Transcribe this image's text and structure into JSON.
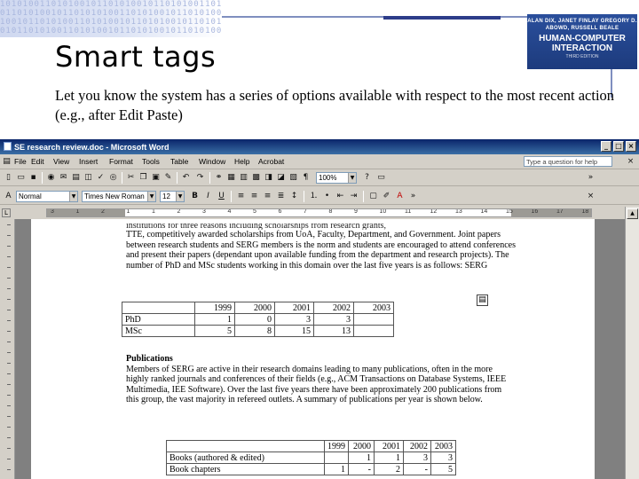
{
  "slide": {
    "title": "Smart tags",
    "subtitle": "Let you know the system has a series of options available with respect to the most recent action (e.g., after Edit Paste)",
    "book_cover": {
      "authors": "ALAN DIX, JANET FINLAY GREGORY D. ABOWD, RUSSELL BEALE",
      "title": "HUMAN-COMPUTER INTERACTION",
      "edition": "THIRD EDITION"
    }
  },
  "word": {
    "window_title": "SE research review.doc - Microsoft Word",
    "menu": [
      "File",
      "Edit",
      "View",
      "Insert",
      "Format",
      "Tools",
      "Table",
      "Window",
      "Help",
      "Acrobat"
    ],
    "ask_box_placeholder": "Type a question for help",
    "style_value": "Normal",
    "font_value": "Times New Roman",
    "size_value": "12",
    "zoom_value": "100%",
    "ruler_numbers": [
      "3",
      "1",
      "2",
      "1",
      "1",
      "2",
      "3",
      "4",
      "5",
      "6",
      "7",
      "8",
      "9",
      "10",
      "11",
      "12",
      "13",
      "14",
      "15",
      "16",
      "17",
      "18"
    ],
    "colors": {
      "titlebar": "#0a246a",
      "chrome": "#d4d0c8",
      "page": "#ffffff"
    }
  },
  "document": {
    "clipped_line": "institutions for three reasons including scholarships from research grants,",
    "para1": "TTE, competitively awarded scholarships from UoA, Faculty, Department, and Government. Joint papers between research students and SERG members is the norm and students are encouraged to attend conferences and present their papers (dependant upon available funding from the department and research projects). The number of PhD and MSc students working in this domain over the last five years is as follows: SERG",
    "table1": {
      "header": [
        "",
        "1999",
        "2000",
        "2001",
        "2002",
        "2003"
      ],
      "rows": [
        [
          "PhD",
          "1",
          "0",
          "3",
          "3",
          ""
        ],
        [
          "MSc",
          "5",
          "8",
          "15",
          "13",
          ""
        ]
      ]
    },
    "pub_heading": "Publications",
    "para2": "Members of SERG are active in their research domains leading to many publications, often in the more highly ranked journals and conferences of their fields (e.g., ACM Transactions on Database Systems, IEEE Multimedia, IEE Software). Over the last five years there have been approximately 200 publications from this group, the vast majority in refereed outlets. A summary of publications per year is shown below.",
    "table2": {
      "header": [
        "",
        "1999",
        "2000",
        "2001",
        "2002",
        "2003"
      ],
      "rows": [
        [
          "Books (authored & edited)",
          "",
          "1",
          "1",
          "3",
          "3"
        ],
        [
          "Book chapters",
          "1",
          "-",
          "2",
          "-",
          "5"
        ]
      ]
    }
  }
}
